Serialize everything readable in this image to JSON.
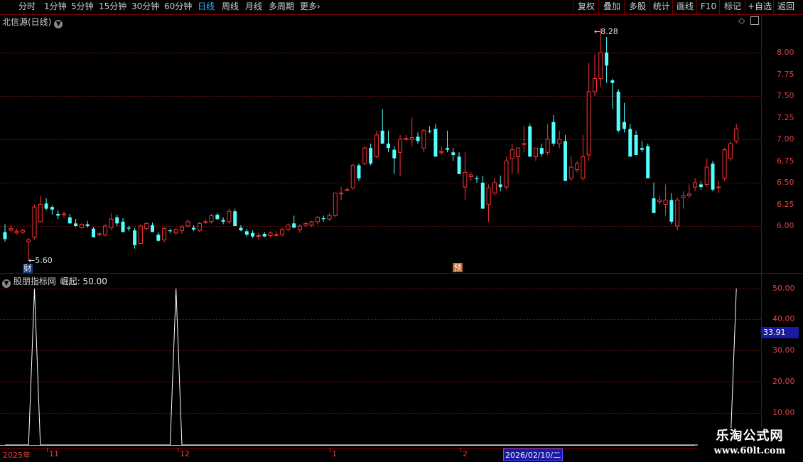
{
  "toolbar": {
    "periods": [
      "分时",
      "1分钟",
      "5分钟",
      "15分钟",
      "30分钟",
      "60分钟",
      "日线",
      "周线",
      "月线",
      "多周期"
    ],
    "active_period": "日线",
    "more": "更多",
    "actions": [
      "复权",
      "叠加",
      "多股",
      "统计",
      "画线",
      "F10",
      "标记",
      "+自选",
      "返回"
    ]
  },
  "main_panel": {
    "title": "北信源(日线)",
    "y_ticks": [
      "8.00",
      "7.75",
      "7.50",
      "7.25",
      "7.00",
      "6.75",
      "6.50",
      "6.25",
      "6.00"
    ],
    "high_label": "8.28",
    "low_label": "5.60",
    "marker_cai": "财",
    "marker_yu": "预"
  },
  "indicator_panel": {
    "name": "股朋指标网",
    "line_name": "崛起",
    "line_value": "50.00",
    "y_ticks": [
      "50.00",
      "40.00",
      "30.00",
      "20.00",
      "10.00"
    ],
    "current_value": "33.91"
  },
  "x_axis": {
    "labels": [
      "2025年",
      "11",
      "12",
      "1",
      "2"
    ],
    "cursor_date": "2026/02/10/二"
  },
  "watermark": {
    "name": "乐淘公式网",
    "url": "www.60lt.com"
  },
  "colors": {
    "up": "#ff3232",
    "down": "#54ffff",
    "grid": "#7a1010",
    "axis_text": "#e04040",
    "active": "#29b6f6"
  },
  "chart_data": [
    {
      "type": "candlestick",
      "title": "北信源(日线)",
      "ylim": [
        5.55,
        8.35
      ],
      "note_high": 8.28,
      "note_low": 5.6,
      "ohlc": [
        [
          5.93,
          6.02,
          5.82,
          5.85
        ],
        [
          5.95,
          6.01,
          5.93,
          5.97
        ],
        [
          5.92,
          5.97,
          5.9,
          5.94
        ],
        [
          5.93,
          5.97,
          5.91,
          5.95
        ],
        [
          5.82,
          5.86,
          5.6,
          5.84
        ],
        [
          5.87,
          6.25,
          5.84,
          6.22
        ],
        [
          6.05,
          6.35,
          6.04,
          6.25
        ],
        [
          6.26,
          6.32,
          6.18,
          6.2
        ],
        [
          6.22,
          6.24,
          6.13,
          6.19
        ],
        [
          6.14,
          6.18,
          6.08,
          6.12
        ],
        [
          6.13,
          6.17,
          6.1,
          6.14
        ],
        [
          6.1,
          6.14,
          6.03,
          6.03
        ],
        [
          6.03,
          6.08,
          5.99,
          6.0
        ],
        [
          5.98,
          6.03,
          5.97,
          6.02
        ],
        [
          6.02,
          6.06,
          5.98,
          6.0
        ],
        [
          5.97,
          5.99,
          5.87,
          5.87
        ],
        [
          5.9,
          5.93,
          5.88,
          5.91
        ],
        [
          5.9,
          6.02,
          5.88,
          6.0
        ],
        [
          5.98,
          6.15,
          5.95,
          6.08
        ],
        [
          6.1,
          6.13,
          6.0,
          6.03
        ],
        [
          6.05,
          6.09,
          5.93,
          5.93
        ],
        [
          5.98,
          6.0,
          5.94,
          5.97
        ],
        [
          5.95,
          5.98,
          5.74,
          5.78
        ],
        [
          5.8,
          6.02,
          5.79,
          6.0
        ],
        [
          5.97,
          6.04,
          5.95,
          6.03
        ],
        [
          6.01,
          6.04,
          5.93,
          5.93
        ],
        [
          5.9,
          5.93,
          5.82,
          5.83
        ],
        [
          5.84,
          5.99,
          5.81,
          5.97
        ],
        [
          5.95,
          5.97,
          5.92,
          5.94
        ],
        [
          5.92,
          5.98,
          5.9,
          5.96
        ],
        [
          5.95,
          6.01,
          5.91,
          5.99
        ],
        [
          6.0,
          6.08,
          5.98,
          6.05
        ],
        [
          5.98,
          6.01,
          5.94,
          5.96
        ],
        [
          5.95,
          6.05,
          5.93,
          6.03
        ],
        [
          6.04,
          6.08,
          6.02,
          6.05
        ],
        [
          6.05,
          6.14,
          6.03,
          6.12
        ],
        [
          6.13,
          6.15,
          6.07,
          6.08
        ],
        [
          6.07,
          6.1,
          6.02,
          6.05
        ],
        [
          6.05,
          6.2,
          6.02,
          6.17
        ],
        [
          6.17,
          6.2,
          6.0,
          6.0
        ],
        [
          5.98,
          6.01,
          5.94,
          5.95
        ],
        [
          5.94,
          5.97,
          5.88,
          5.9
        ],
        [
          5.92,
          5.95,
          5.86,
          5.88
        ],
        [
          5.89,
          5.92,
          5.84,
          5.89
        ],
        [
          5.91,
          5.93,
          5.87,
          5.88
        ],
        [
          5.89,
          5.94,
          5.87,
          5.92
        ],
        [
          5.9,
          5.94,
          5.88,
          5.9
        ],
        [
          5.9,
          5.98,
          5.88,
          5.96
        ],
        [
          5.96,
          6.03,
          5.94,
          6.01
        ],
        [
          6.03,
          6.12,
          5.98,
          5.98
        ],
        [
          5.96,
          6.02,
          5.92,
          6.0
        ],
        [
          6.01,
          6.05,
          5.99,
          6.03
        ],
        [
          6.01,
          6.06,
          5.99,
          6.05
        ],
        [
          6.05,
          6.12,
          6.02,
          6.1
        ],
        [
          6.09,
          6.12,
          6.05,
          6.08
        ],
        [
          6.08,
          6.15,
          6.06,
          6.12
        ],
        [
          6.12,
          6.38,
          6.1,
          6.38
        ],
        [
          6.38,
          6.45,
          6.3,
          6.38
        ],
        [
          6.42,
          6.45,
          6.4,
          6.42
        ],
        [
          6.44,
          6.72,
          6.42,
          6.7
        ],
        [
          6.7,
          6.72,
          6.52,
          6.55
        ],
        [
          6.72,
          6.92,
          6.7,
          6.9
        ],
        [
          6.9,
          6.95,
          6.7,
          6.72
        ],
        [
          6.8,
          7.1,
          6.78,
          7.05
        ],
        [
          7.1,
          7.35,
          6.95,
          6.95
        ],
        [
          6.95,
          7.1,
          6.85,
          6.9
        ],
        [
          6.88,
          6.92,
          6.6,
          6.78
        ],
        [
          6.85,
          7.05,
          6.58,
          7.0
        ],
        [
          7.0,
          7.05,
          6.98,
          7.01
        ],
        [
          7.0,
          7.25,
          6.92,
          7.02
        ],
        [
          7.03,
          7.08,
          6.95,
          6.98
        ],
        [
          6.9,
          7.12,
          6.85,
          7.1
        ],
        [
          7.1,
          7.15,
          7.07,
          7.09
        ],
        [
          7.12,
          7.18,
          6.8,
          6.8
        ],
        [
          6.85,
          6.92,
          6.82,
          6.86
        ],
        [
          6.9,
          7.1,
          6.85,
          6.88
        ],
        [
          6.85,
          6.9,
          6.75,
          6.82
        ],
        [
          6.8,
          6.85,
          6.6,
          6.6
        ],
        [
          6.45,
          6.85,
          6.3,
          6.62
        ],
        [
          6.57,
          6.62,
          6.52,
          6.59
        ],
        [
          6.55,
          6.58,
          6.5,
          6.54
        ],
        [
          6.5,
          6.58,
          6.2,
          6.2
        ],
        [
          6.25,
          6.48,
          6.05,
          6.44
        ],
        [
          6.38,
          6.55,
          6.35,
          6.5
        ],
        [
          6.48,
          6.58,
          6.4,
          6.45
        ],
        [
          6.45,
          6.8,
          6.42,
          6.75
        ],
        [
          6.78,
          6.95,
          6.6,
          6.88
        ],
        [
          6.8,
          6.9,
          6.6,
          6.9
        ],
        [
          6.95,
          7.15,
          6.85,
          6.95
        ],
        [
          7.15,
          7.18,
          6.8,
          6.8
        ],
        [
          6.8,
          6.85,
          6.75,
          6.9
        ],
        [
          6.9,
          6.95,
          6.8,
          6.83
        ],
        [
          6.85,
          7.18,
          6.82,
          7.0
        ],
        [
          7.2,
          7.28,
          6.92,
          6.95
        ],
        [
          6.95,
          7.1,
          6.9,
          7.0
        ],
        [
          6.98,
          7.05,
          6.52,
          6.52
        ],
        [
          6.55,
          6.8,
          6.52,
          6.68
        ],
        [
          6.65,
          6.75,
          6.62,
          6.72
        ],
        [
          6.55,
          7.05,
          6.52,
          6.8
        ],
        [
          6.82,
          7.88,
          6.75,
          7.55
        ],
        [
          7.55,
          7.98,
          7.5,
          7.7
        ],
        [
          7.7,
          8.28,
          7.6,
          8.0
        ],
        [
          8.0,
          8.18,
          7.65,
          7.85
        ],
        [
          7.68,
          7.7,
          7.35,
          7.65
        ],
        [
          7.55,
          7.58,
          7.08,
          7.1
        ],
        [
          7.2,
          7.42,
          7.08,
          7.12
        ],
        [
          7.12,
          7.18,
          6.8,
          6.8
        ],
        [
          7.05,
          7.1,
          6.82,
          6.82
        ],
        [
          6.9,
          6.98,
          6.85,
          6.88
        ],
        [
          6.92,
          6.95,
          6.55,
          6.55
        ],
        [
          6.32,
          6.5,
          6.15,
          6.15
        ],
        [
          6.28,
          6.35,
          6.25,
          6.3
        ],
        [
          6.25,
          6.48,
          6.12,
          6.3
        ],
        [
          6.3,
          6.38,
          6.02,
          6.05
        ],
        [
          6.0,
          6.33,
          5.95,
          6.3
        ],
        [
          6.33,
          6.4,
          6.2,
          6.35
        ],
        [
          6.35,
          6.48,
          6.32,
          6.37
        ],
        [
          6.45,
          6.55,
          6.4,
          6.5
        ],
        [
          6.48,
          6.52,
          6.42,
          6.45
        ],
        [
          6.48,
          6.78,
          6.45,
          6.68
        ],
        [
          6.72,
          6.75,
          6.4,
          6.42
        ],
        [
          6.45,
          6.52,
          6.38,
          6.45
        ],
        [
          6.55,
          6.9,
          6.52,
          6.88
        ],
        [
          6.78,
          6.98,
          6.75,
          6.95
        ],
        [
          6.98,
          7.18,
          6.95,
          7.12
        ]
      ]
    },
    {
      "type": "line",
      "title": "股朋指标网",
      "series": [
        {
          "name": "崛起",
          "last_value": 50
        }
      ],
      "ylim": [
        0,
        55
      ],
      "spikes": [
        {
          "index": 5,
          "value": 50
        },
        {
          "index": 29,
          "value": 50
        },
        {
          "index": 124,
          "value": 50
        }
      ]
    }
  ]
}
